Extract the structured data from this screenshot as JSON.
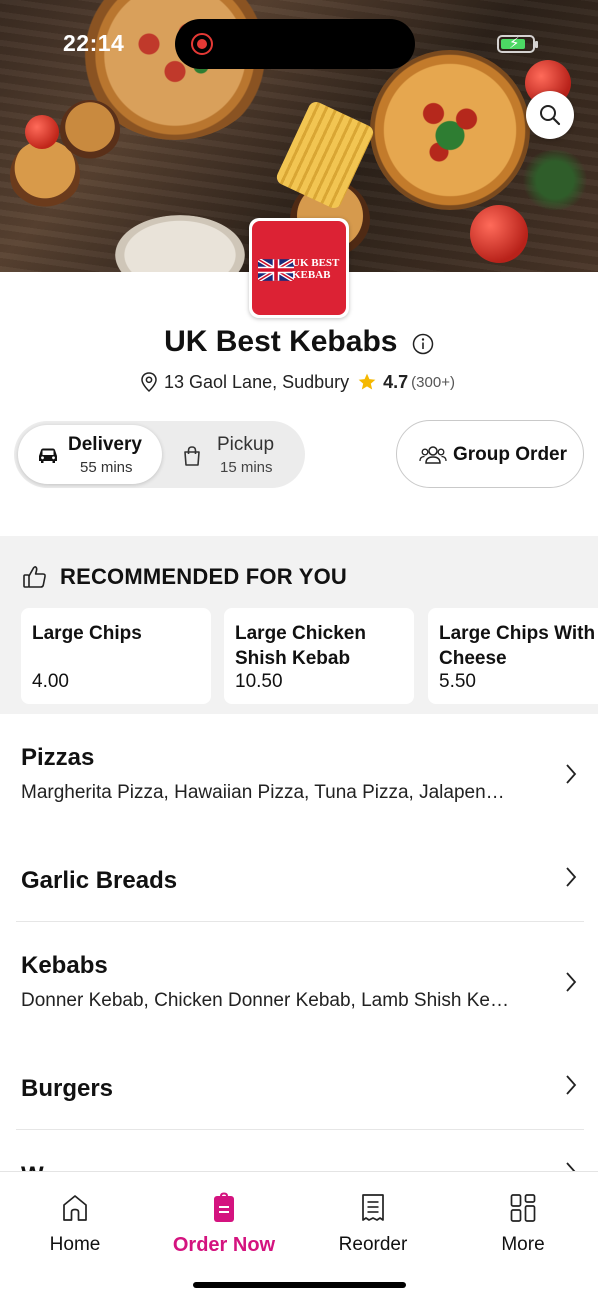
{
  "status_bar": {
    "time": "22:14"
  },
  "restaurant": {
    "logo_text_line1": "UK BEST",
    "logo_text_line2": "KEBAB",
    "name": "UK Best Kebabs",
    "address": "13 Gaol Lane, Sudbury",
    "rating": "4.7",
    "rating_count": "(300+)"
  },
  "order_toggle": {
    "options": [
      {
        "label": "Delivery",
        "time": "55 mins",
        "selected": true
      },
      {
        "label": "Pickup",
        "time": "15 mins",
        "selected": false
      }
    ]
  },
  "group_order": {
    "label": "Group Order"
  },
  "recommended": {
    "heading": "RECOMMENDED FOR YOU",
    "items": [
      {
        "name": "Large Chips",
        "price": "4.00"
      },
      {
        "name": "Large Chicken Shish Kebab",
        "price": "10.50"
      },
      {
        "name": "Large Chips With Cheese",
        "price": "5.50"
      }
    ]
  },
  "categories": [
    {
      "name": "Pizzas",
      "description": "Margherita Pizza, Hawaiian Pizza, Tuna Pizza, Jalapen…"
    },
    {
      "name": "Garlic Breads",
      "description": ""
    },
    {
      "name": "Kebabs",
      "description": "Donner Kebab, Chicken Donner Kebab, Lamb Shish Ke…"
    },
    {
      "name": "Burgers",
      "description": ""
    },
    {
      "name": "W",
      "description": ""
    }
  ],
  "tab_bar": {
    "tabs": [
      {
        "label": "Home",
        "icon": "home-icon"
      },
      {
        "label": "Order Now",
        "icon": "order-bag-icon",
        "active": true
      },
      {
        "label": "Reorder",
        "icon": "receipt-icon"
      },
      {
        "label": "More",
        "icon": "grid-icon"
      }
    ]
  },
  "colors": {
    "accent": "#d4137f",
    "rating_star": "#f5b800",
    "logo_red": "#dc2234"
  }
}
